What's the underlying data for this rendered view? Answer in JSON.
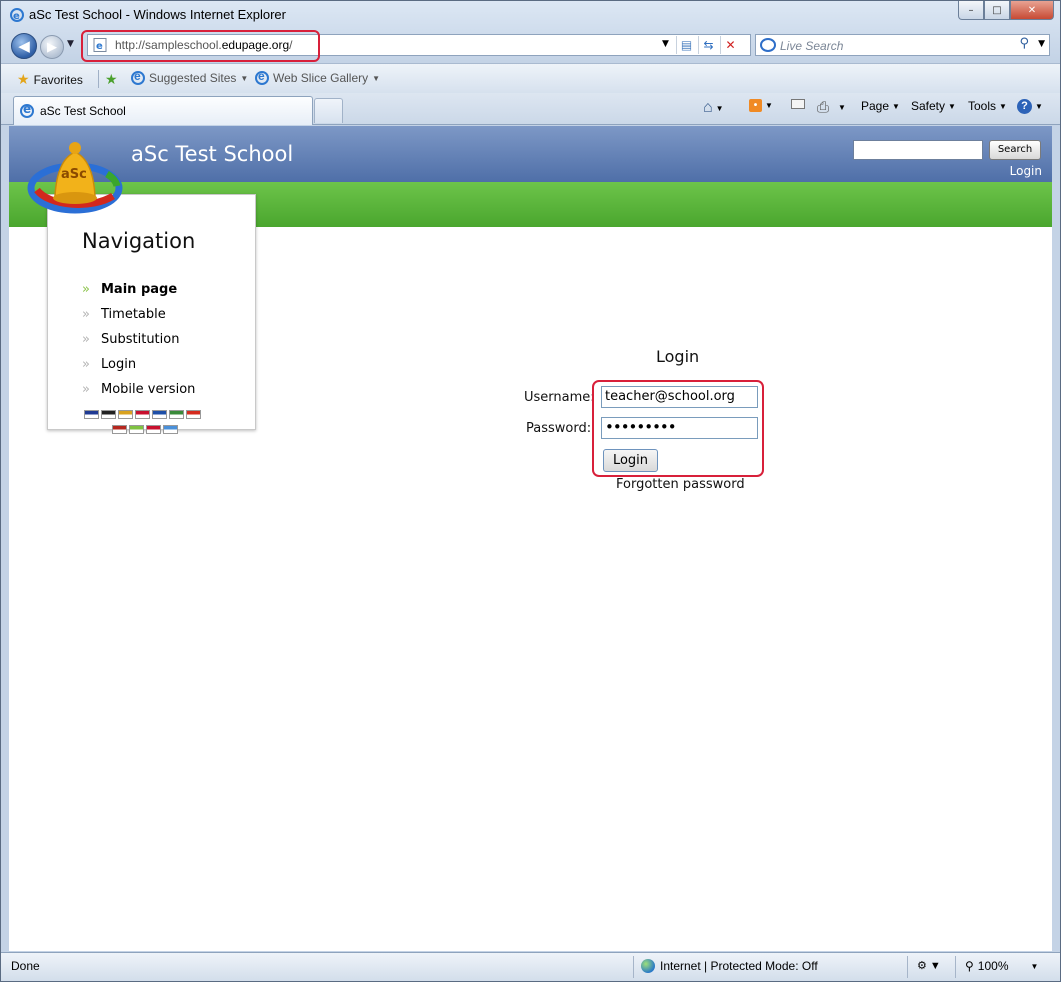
{
  "window": {
    "title": "aSc Test School - Windows Internet Explorer",
    "minimize_glyph": "–",
    "maximize_glyph": "□",
    "close_glyph": "✕"
  },
  "address": {
    "url_prefix": "http://sampleschool.",
    "url_host": "edupage.org",
    "url_suffix": "/",
    "search_placeholder": "Live Search"
  },
  "favorites_bar": {
    "favorites_label": "Favorites",
    "suggested_sites_label": "Suggested Sites",
    "web_slice_gallery_label": "Web Slice Gallery"
  },
  "tabs": [
    {
      "label": "aSc Test School"
    }
  ],
  "command_bar": {
    "page_label": "Page",
    "safety_label": "Safety",
    "tools_label": "Tools"
  },
  "site": {
    "title": "aSc Test School",
    "search_button": "Search",
    "login_link": "Login",
    "logo_text": "aSc"
  },
  "navigation": {
    "title": "Navigation",
    "items": [
      {
        "label": "Main page",
        "active": true
      },
      {
        "label": "Timetable",
        "active": false
      },
      {
        "label": "Substitution",
        "active": false
      },
      {
        "label": "Login",
        "active": false
      },
      {
        "label": "Mobile version",
        "active": false
      }
    ],
    "flags_row1": [
      "#1f3a93",
      "#222222",
      "#d9a21f",
      "#c8102e",
      "#1e4fa8",
      "#3a8a3a",
      "#d52b1e"
    ],
    "flags_row2": [
      "#b5261e",
      "#7fc241",
      "#c8102e",
      "#4a90d9"
    ]
  },
  "login": {
    "title": "Login",
    "username_label": "Username:",
    "username_value": "teacher@school.org",
    "password_label": "Password:",
    "password_value": "•••••••••",
    "login_button": "Login",
    "forgotten_password": "Forgotten password"
  },
  "status": {
    "text": "Done",
    "zone": "Internet | Protected Mode: Off",
    "zoom": "100%"
  }
}
